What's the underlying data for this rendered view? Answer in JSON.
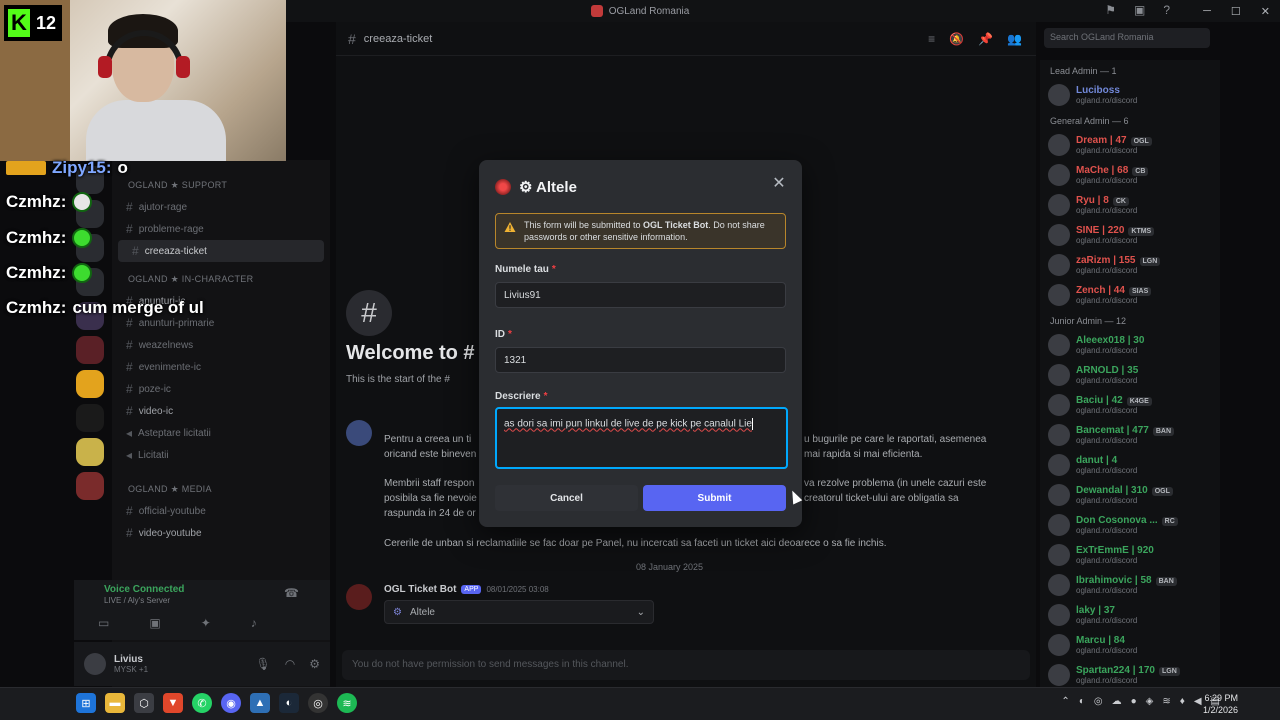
{
  "window": {
    "title": "OGLand Romania"
  },
  "stream": {
    "viewer_count": "12",
    "kick_logo": "K"
  },
  "stream_chat": [
    {
      "user": "Zipy15:",
      "text": "o"
    },
    {
      "user": "Czmhz:",
      "text": ""
    },
    {
      "user": "Czmhz:",
      "text": ""
    },
    {
      "user": "Czmhz:",
      "text": ""
    },
    {
      "user": "Czmhz:",
      "text": "cum merge of ul"
    }
  ],
  "channel_header": {
    "name": "creeaza-ticket"
  },
  "search": {
    "placeholder": "Search OGLand Romania"
  },
  "channels": {
    "category_support": "OGLAND ★ SUPPORT",
    "items_support": [
      "ajutor-rage",
      "probleme-rage",
      "creeaza-ticket"
    ],
    "category_ic": "OGLAND ★ IN-CHARACTER",
    "items_ic": [
      "anunturi-ic",
      "anunturi-primarie",
      "weazelnews",
      "evenimente-ic",
      "poze-ic",
      "video-ic",
      "Asteptare licitatii",
      "Licitatii"
    ],
    "category_media": "OGLAND ★ MEDIA",
    "items_media": [
      "official-youtube",
      "video-youtube"
    ]
  },
  "voice": {
    "status": "Voice Connected",
    "sub": "LIVE / Aly's Server"
  },
  "user": {
    "name": "Livius",
    "tag": "MYSK +1"
  },
  "welcome": {
    "title": "Welcome to #",
    "subtitle": "This is the start of the #"
  },
  "messages": {
    "body1": "Pentru a creea un ti",
    "body1b": "oricand este bineven",
    "body1_right": "u bugurile pe care le raportati, asemenea",
    "body1_right_b": "mai rapida si mai eficienta.",
    "body2": "Membrii staff respon",
    "body2b": "posibila sa fie nevoie",
    "body2c": "raspunda in 24 de or",
    "body2_right": "va rezolve problema (in unele cazuri este",
    "body2_right_b": "creatorul ticket-ului are obligatia sa",
    "body3": "Cererile de unban si reclamatiile se fac doar pe Panel, nu incercati sa faceti un ticket aici deoarece o sa fie inchis.",
    "date_divider": "08 January 2025",
    "bot_name": "OGL Ticket Bot",
    "bot_badge": "APP",
    "bot_time": "08/01/2025 03:08",
    "select_value": "Altele",
    "composer_placeholder": "You do not have permission to send messages in this channel."
  },
  "members": [
    {
      "group": "Lead Admin — 1",
      "rows": [
        {
          "name": "Luciboss",
          "color": "#7289da"
        }
      ]
    },
    {
      "group": "General Admin — 6",
      "rows": [
        {
          "name": "Dream | 47",
          "tag": "OGL",
          "color": "#e0524d"
        },
        {
          "name": "MaChe | 68",
          "tag": "CB",
          "color": "#e0524d"
        },
        {
          "name": "Ryu | 8",
          "tag": "CK",
          "color": "#e0524d"
        },
        {
          "name": "SINE | 220",
          "tag": "KTMS",
          "color": "#e0524d"
        },
        {
          "name": "zaRizm | 155",
          "tag": "LGN",
          "color": "#e0524d"
        },
        {
          "name": "Zench | 44",
          "tag": "SIAS",
          "color": "#e0524d"
        }
      ]
    },
    {
      "group": "Junior Admin — 12",
      "rows": [
        {
          "name": "Aleeex018 | 30",
          "color": "#3ba55d"
        },
        {
          "name": "ARNOLD | 35",
          "color": "#3ba55d"
        },
        {
          "name": "Baciu | 42",
          "tag": "K4GE",
          "color": "#3ba55d"
        },
        {
          "name": "Bancemat | 477",
          "tag": "BAN",
          "color": "#3ba55d"
        },
        {
          "name": "danut | 4",
          "color": "#3ba55d"
        },
        {
          "name": "Dewandal | 310",
          "tag": "OGL",
          "color": "#3ba55d"
        },
        {
          "name": "Don Cosonova ...",
          "tag": "RC",
          "color": "#3ba55d"
        },
        {
          "name": "ExTrEmmE | 920",
          "color": "#3ba55d"
        },
        {
          "name": "Ibrahimovic | 58",
          "tag": "BAN",
          "color": "#3ba55d"
        },
        {
          "name": "laky | 37",
          "color": "#3ba55d"
        },
        {
          "name": "Marcu | 84",
          "color": "#3ba55d"
        },
        {
          "name": "Spartan224 | 170",
          "tag": "LGN",
          "color": "#3ba55d"
        }
      ]
    }
  ],
  "member_sub": "ogland.ro/discord",
  "modal": {
    "title": "⚙ Altele",
    "warning_prefix": "This form will be submitted to ",
    "warning_bold": "OGL Ticket Bot",
    "warning_suffix": ". Do not share passwords or other sensitive information.",
    "field1_label": "Numele tau",
    "field1_value": "Livius91",
    "field2_label": "ID",
    "field2_value": "1321",
    "field3_label": "Descriere",
    "field3_value": "as dori sa imi pun linkul de live de pe kick pe canalul Lie",
    "required_mark": "*",
    "cancel_label": "Cancel",
    "submit_label": "Submit"
  },
  "clock": {
    "time": "6:29 PM",
    "date": "1/2/2026"
  },
  "colors": {
    "accent": "#5865f2",
    "focus": "#00a8fc",
    "warning_border": "#b8862b",
    "kick_green": "#53fc18"
  }
}
